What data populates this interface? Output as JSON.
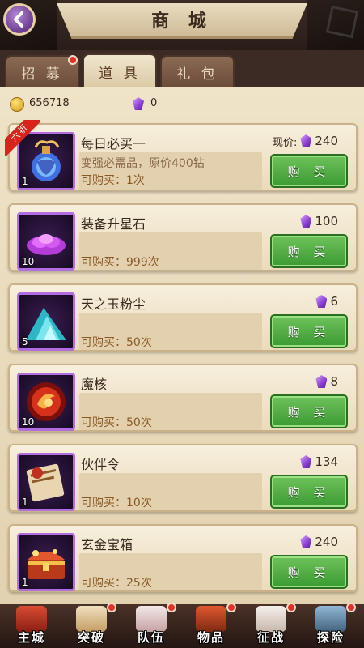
{
  "header": {
    "title": "商 城",
    "back_icon": "chevron-left-icon"
  },
  "tabs": [
    {
      "label": "招 募",
      "active": false,
      "has_dot": true
    },
    {
      "label": "道 具",
      "active": true,
      "has_dot": false
    },
    {
      "label": "礼 包",
      "active": false,
      "has_dot": false
    }
  ],
  "currency": {
    "gold": "656718",
    "gems": "0"
  },
  "items": [
    {
      "name": "每日必买一",
      "badge": "六折",
      "desc": "变强必需品，原价400钻",
      "limit": "可购买：1次",
      "price_prefix": "现价:",
      "price": "240",
      "count": "1",
      "buy_label": "购 买"
    },
    {
      "name": "装备升星石",
      "limit": "可购买：999次",
      "price": "100",
      "count": "10",
      "buy_label": "购 买"
    },
    {
      "name": "天之玉粉尘",
      "limit": "可购买：50次",
      "price": "6",
      "count": "5",
      "buy_label": "购 买"
    },
    {
      "name": "魔核",
      "limit": "可购买：50次",
      "price": "8",
      "count": "10",
      "buy_label": "购 买"
    },
    {
      "name": "伙伴令",
      "limit": "可购买：10次",
      "price": "134",
      "count": "1",
      "buy_label": "购 买"
    },
    {
      "name": "玄金宝箱",
      "limit": "可购买：25次",
      "price": "240",
      "count": "1",
      "buy_label": "购 买"
    }
  ],
  "bottom_nav": [
    {
      "label": "主城",
      "icon": "castle-icon",
      "has_dot": false
    },
    {
      "label": "突破",
      "icon": "scroll-icon",
      "has_dot": true
    },
    {
      "label": "队伍",
      "icon": "team-icon",
      "has_dot": true
    },
    {
      "label": "物品",
      "icon": "chest-icon",
      "has_dot": true
    },
    {
      "label": "征战",
      "icon": "mask-icon",
      "has_dot": true
    },
    {
      "label": "探险",
      "icon": "explore-icon",
      "has_dot": true
    }
  ],
  "colors": {
    "buy_green": "#3b9a32",
    "gem_purple": "#8a3fd1",
    "badge_red": "#d8241c"
  }
}
